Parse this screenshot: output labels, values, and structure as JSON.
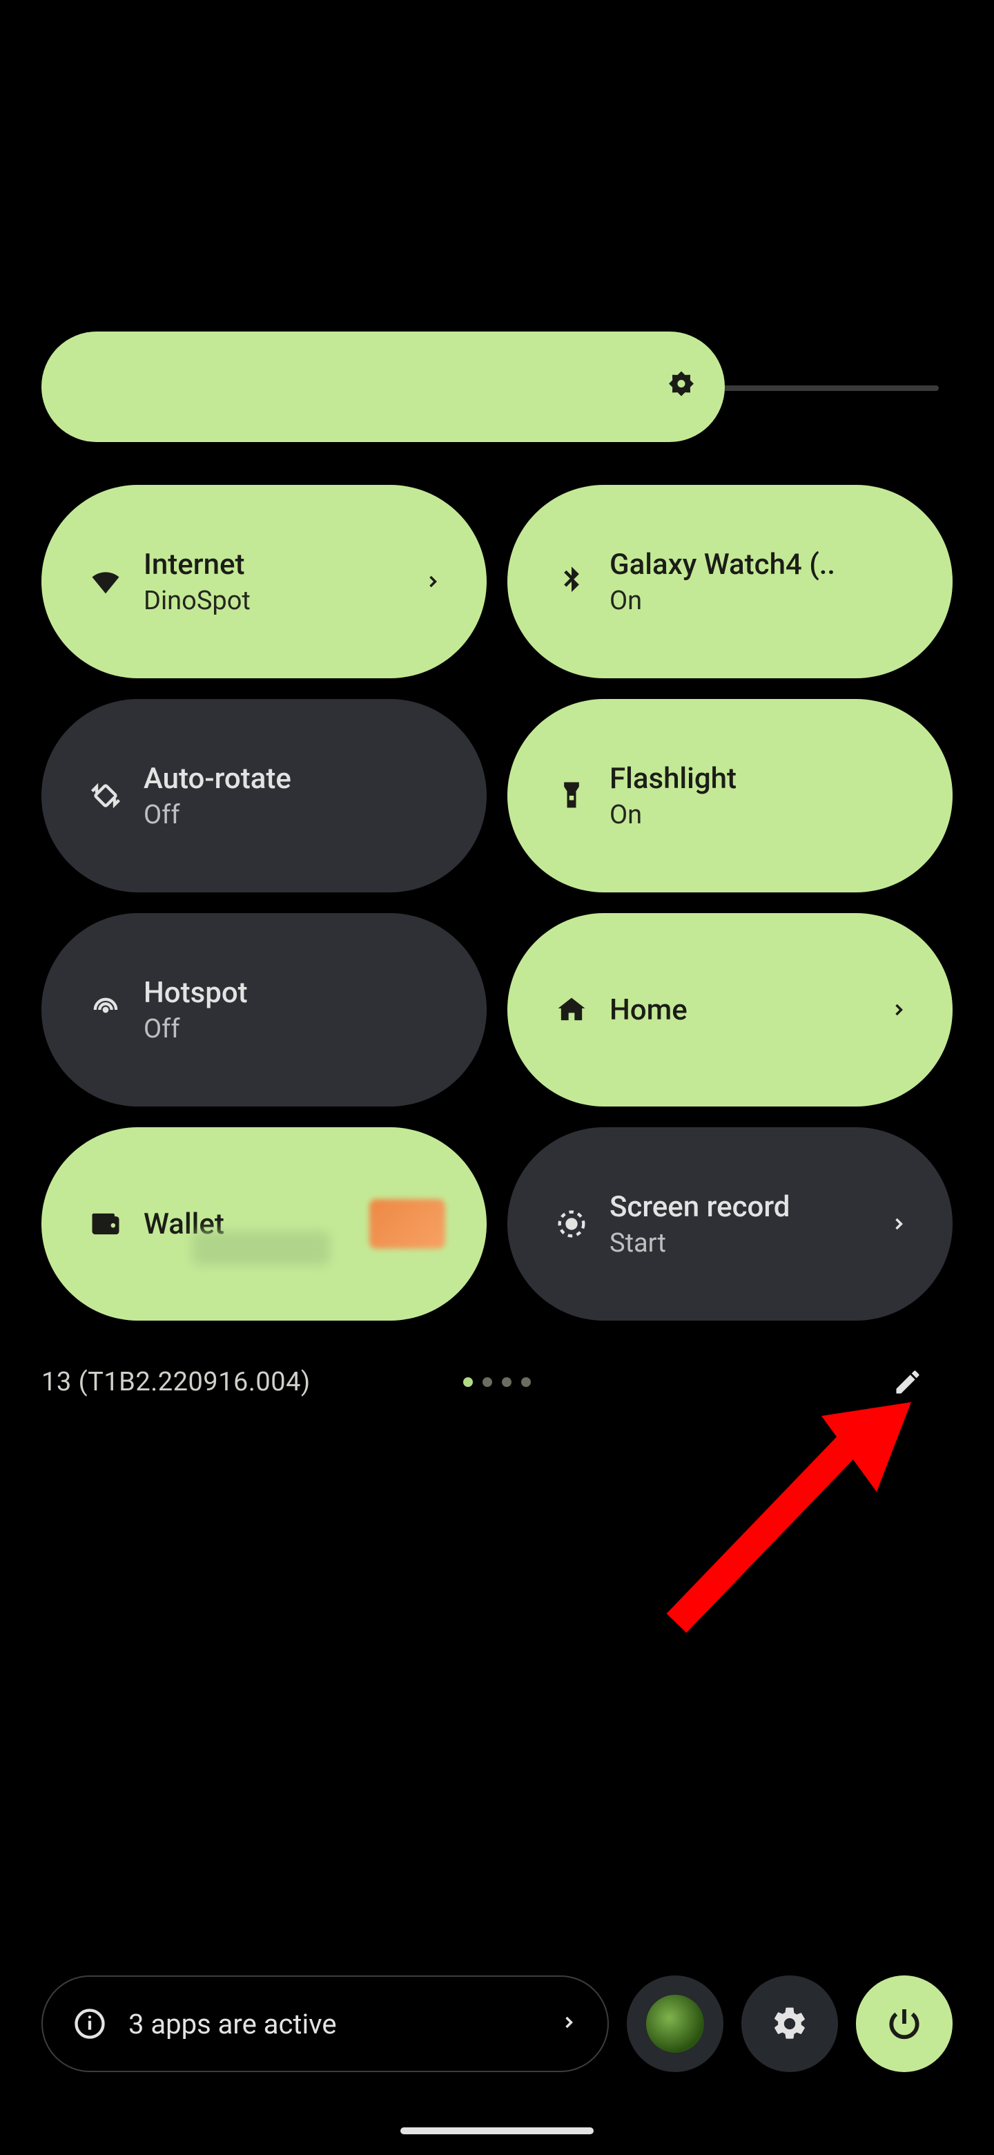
{
  "brightness": {
    "percent": 75
  },
  "tiles": [
    {
      "id": "internet",
      "title": "Internet",
      "sub": "DinoSpot",
      "state": "on",
      "chevron": true
    },
    {
      "id": "bluetooth",
      "title": "Galaxy Watch4 (..",
      "sub": "On",
      "state": "on",
      "chevron": false
    },
    {
      "id": "autorotate",
      "title": "Auto-rotate",
      "sub": "Off",
      "state": "off",
      "chevron": false
    },
    {
      "id": "flashlight",
      "title": "Flashlight",
      "sub": "On",
      "state": "on",
      "chevron": false
    },
    {
      "id": "hotspot",
      "title": "Hotspot",
      "sub": "Off",
      "state": "off",
      "chevron": false
    },
    {
      "id": "home",
      "title": "Home",
      "sub": "",
      "state": "on",
      "chevron": true
    },
    {
      "id": "wallet",
      "title": "Wallet",
      "sub": "",
      "state": "on",
      "chevron": false
    },
    {
      "id": "screenrecord",
      "title": "Screen record",
      "sub": "Start",
      "state": "off",
      "chevron": true
    }
  ],
  "build": "13 (T1B2.220916.004)",
  "pages": {
    "count": 4,
    "active": 0
  },
  "bottom": {
    "active_apps": "3 apps are active"
  },
  "colors": {
    "accent": "#c4e996",
    "tile_off": "#2e3035"
  }
}
